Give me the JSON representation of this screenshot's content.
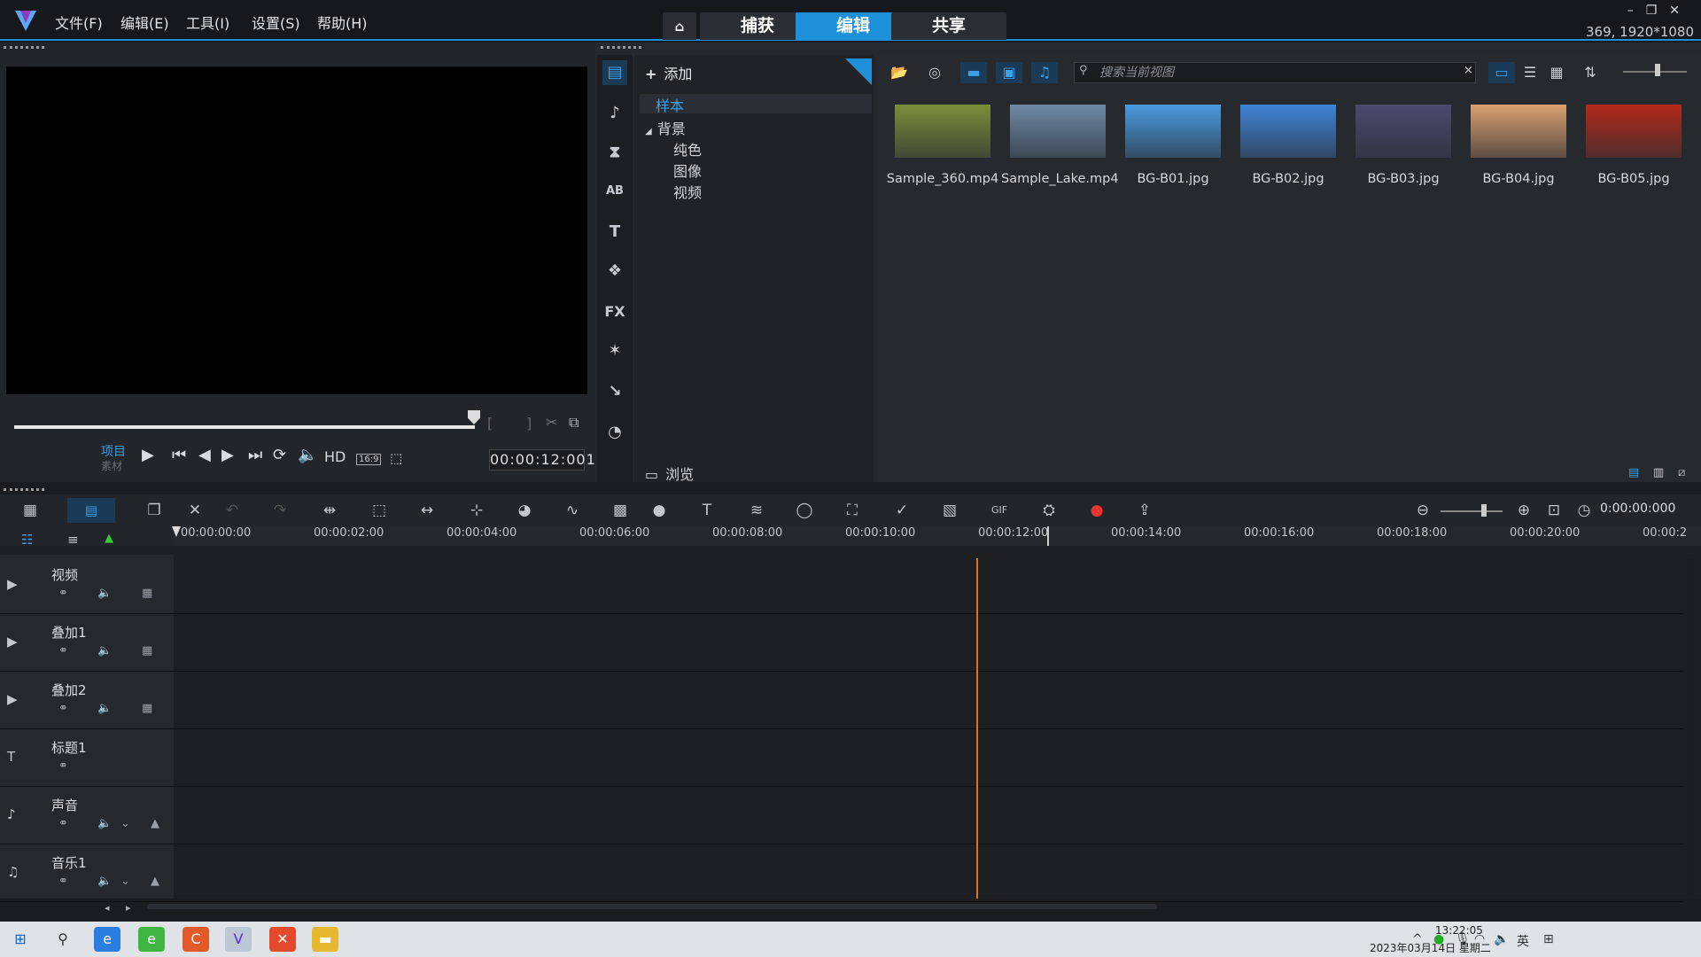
{
  "menu": [
    "文件(F)",
    "编辑(E)",
    "工具(I)",
    "设置(S)",
    "帮助(H)"
  ],
  "tabs": [
    "捕获",
    "编辑",
    "共享"
  ],
  "resolution_info": "369, 1920*1080",
  "player": {
    "project_label": "项目",
    "clip_label": "素材",
    "timecode": "00:00:12:001",
    "hd_label": "HD",
    "aspect": "16:9"
  },
  "library": {
    "add_label": "添加",
    "tree": {
      "sample": "样本",
      "background": "背景",
      "children": [
        "纯色",
        "图像",
        "视频"
      ]
    },
    "browse_label": "浏览",
    "search_placeholder": "搜索当前视图",
    "thumbnails": [
      {
        "name": "Sample_360.mp4",
        "color": "#7a8f3a"
      },
      {
        "name": "Sample_Lake.mp4",
        "color": "#6f8aa6"
      },
      {
        "name": "BG-B01.jpg",
        "color": "#4a9be0"
      },
      {
        "name": "BG-B02.jpg",
        "color": "#3f86d8"
      },
      {
        "name": "BG-B03.jpg",
        "color": "#4b4a6e"
      },
      {
        "name": "BG-B04.jpg",
        "color": "#d9a070"
      },
      {
        "name": "BG-B05.jpg",
        "color": "#b22a1a"
      }
    ]
  },
  "timeline": {
    "time_display": "0:00:00:000",
    "ruler": [
      "00:00:00:00",
      "00:00:02:00",
      "00:00:04:00",
      "00:00:06:00",
      "00:00:08:00",
      "00:00:10:00",
      "00:00:12:00",
      "00:00:14:00",
      "00:00:16:00",
      "00:00:18:00",
      "00:00:20:00",
      "00:00:2"
    ],
    "tracks": [
      "视频",
      "叠加1",
      "叠加2",
      "标题1",
      "声音",
      "音乐1"
    ]
  },
  "taskbar": {
    "time": "13:22:05",
    "date": "2023年03月14日 星期二",
    "ime": "英"
  }
}
